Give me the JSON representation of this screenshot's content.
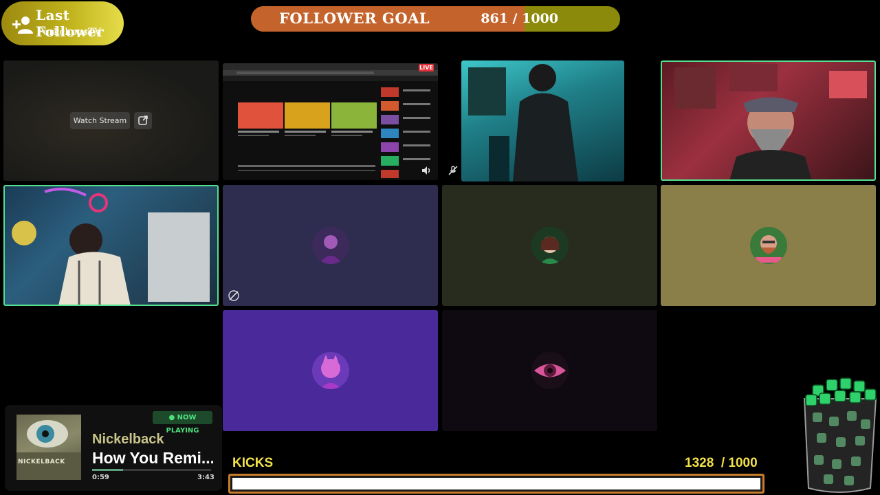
{
  "last_follower": {
    "title": "Last Follower",
    "name": "PorkchopsTV",
    "icon": "add-person-icon"
  },
  "follower_goal": {
    "label": "FOLLOWER GOAL",
    "current": 861,
    "target": 1000,
    "count_text": "861  /  1000",
    "fill_color": "#c4642c",
    "track_color": "#8c8a0a"
  },
  "tiles": {
    "stream_preview": {
      "button_label": "Watch Stream",
      "popout_icon": "popout-icon"
    },
    "screen_share": {
      "live_label": "LIVE"
    }
  },
  "now_playing": {
    "badge": "● NOW PLAYING",
    "artist": "Nickelback",
    "track": "How You Remind Me",
    "track_display": "How You Remi...",
    "album_art_text": "NICKELBACK",
    "elapsed": "0:59",
    "total": "3:43",
    "progress_fraction": 0.26
  },
  "kicks": {
    "label": "KICKS",
    "count_text": "1328  / 1000",
    "current": 1328,
    "target": 1000,
    "progress_fraction": 1.0,
    "border_color": "#c87c2a",
    "text_color": "#f2e24a"
  },
  "colors": {
    "speaking_outline": "#55e08f"
  }
}
